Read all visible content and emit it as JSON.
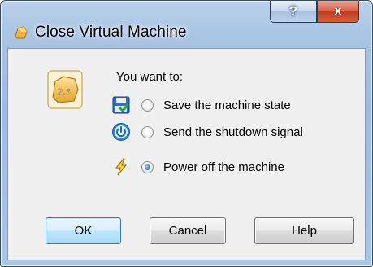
{
  "window": {
    "title": "Close Virtual Machine",
    "help_glyph": "?",
    "close_glyph": "x"
  },
  "dialog": {
    "vm_badge": "2.6",
    "prompt": "You want to:",
    "options": [
      {
        "label": "Save the machine state",
        "icon": "save-state-icon",
        "checked": false
      },
      {
        "label": "Send the shutdown signal",
        "icon": "power-button-icon",
        "checked": false
      },
      {
        "label": "Power off the machine",
        "icon": "lightning-icon",
        "checked": true
      }
    ]
  },
  "buttons": {
    "ok": "OK",
    "cancel": "Cancel",
    "help": "Help"
  },
  "colors": {
    "frame": "#9dbbe0",
    "client": "#f0f0f0",
    "close_button": "#c13b1d",
    "default_button": "#3c7fb1"
  }
}
